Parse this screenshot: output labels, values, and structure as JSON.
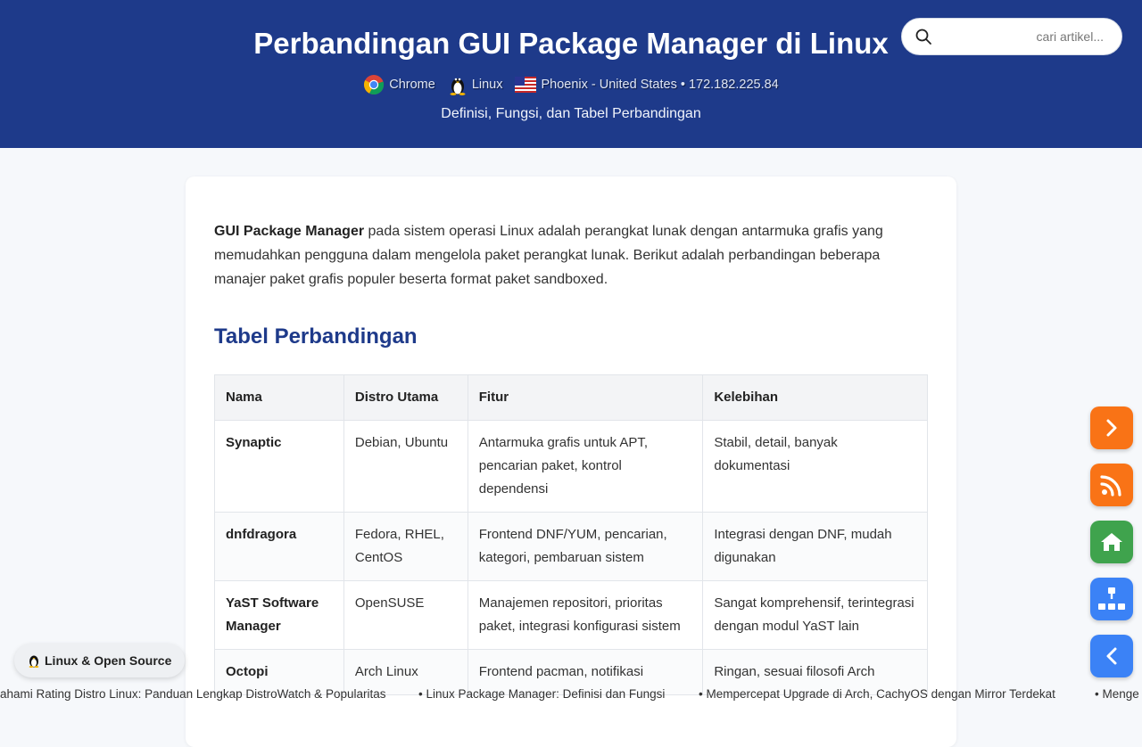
{
  "header": {
    "title": "Perbandingan GUI Package Manager di Linux",
    "browser": "Chrome",
    "os": "Linux",
    "location": "Phoenix - United States • 172.182.225.84",
    "subtitle": "Definisi, Fungsi, dan Tabel Perbandingan",
    "bg_color": "#1e3a8a"
  },
  "search": {
    "placeholder": "cari artikel...",
    "icon": "search-icon"
  },
  "article": {
    "intro_bold": "GUI Package Manager",
    "intro_text": " pada sistem operasi Linux adalah perangkat lunak dengan antarmuka grafis yang memudahkan pengguna dalam mengelola paket perangkat lunak. Berikut adalah perbandingan beberapa manajer paket grafis populer beserta format paket sandboxed.",
    "section_title": "Tabel Perbandingan",
    "table": {
      "headers": [
        "Nama",
        "Distro Utama",
        "Fitur",
        "Kelebihan"
      ],
      "rows": [
        [
          "Synaptic",
          "Debian, Ubuntu",
          "Antarmuka grafis untuk APT, pencarian paket, kontrol dependensi",
          "Stabil, detail, banyak dokumentasi"
        ],
        [
          "dnfdragora",
          "Fedora, RHEL, CentOS",
          "Frontend DNF/YUM, pencarian, kategori, pembaruan sistem",
          "Integrasi dengan DNF, mudah digunakan"
        ],
        [
          "YaST Software Manager",
          "OpenSUSE",
          "Manajemen repositori, prioritas paket, integrasi konfigurasi sistem",
          "Sangat komprehensif, terintegrasi dengan modul YaST lain"
        ],
        [
          "Octopi",
          "Arch Linux",
          "Frontend pacman, notifikasi",
          "Ringan, sesuai filosofi Arch"
        ]
      ]
    }
  },
  "floating_buttons": [
    {
      "name": "next-button",
      "icon": "chevron-right-icon",
      "color": "#f97316"
    },
    {
      "name": "rss-button",
      "icon": "rss-icon",
      "color": "#f97316"
    },
    {
      "name": "home-button",
      "icon": "home-icon",
      "color": "#3fa34d"
    },
    {
      "name": "sitemap-button",
      "icon": "sitemap-icon",
      "color": "#3b82f6"
    },
    {
      "name": "back-button",
      "icon": "chevron-left-icon",
      "color": "#3b82f6"
    }
  ],
  "badge": {
    "label": "Linux & Open Source"
  },
  "ticker": {
    "items": [
      "ahami Rating Distro Linux: Panduan Lengkap DistroWatch & Popularitas",
      "•  Linux Package Manager: Definisi dan Fungsi",
      "•  Mempercepat Upgrade di Arch, CachyOS dengan Mirror Terdekat",
      "•  Menge"
    ]
  }
}
